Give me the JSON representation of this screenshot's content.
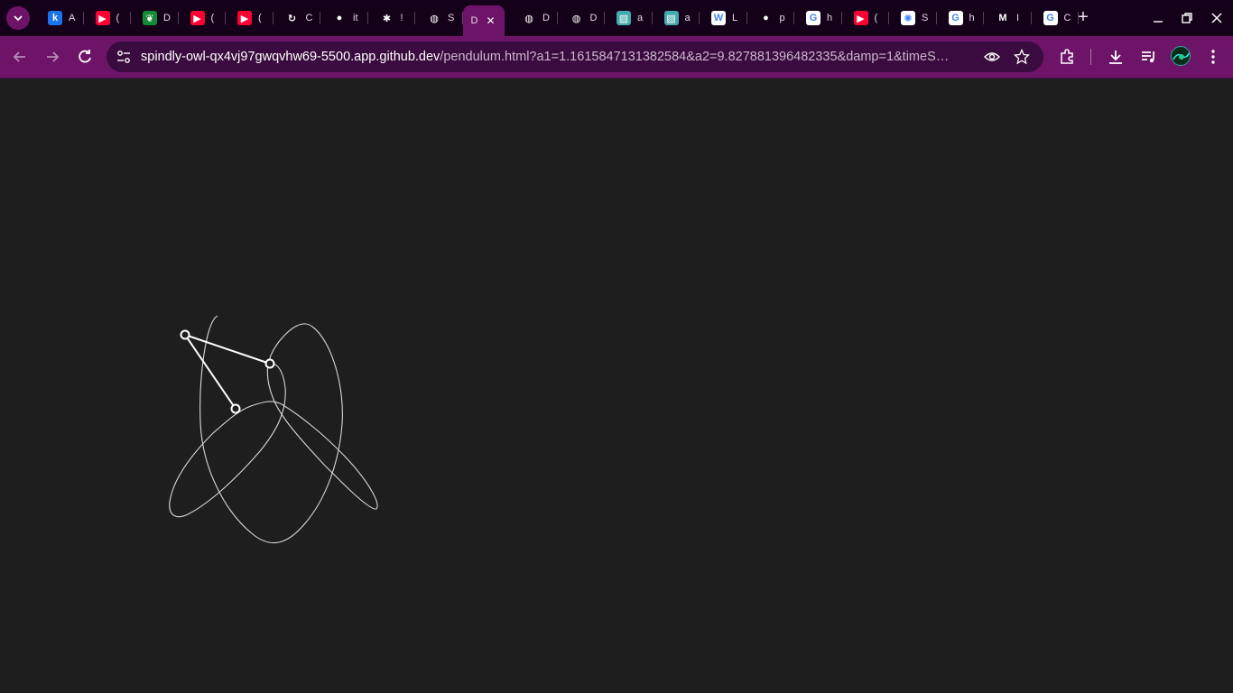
{
  "browser": {
    "tabs": [
      {
        "title": "A",
        "icon": "k-icon",
        "color": "#1a73e8",
        "glyph": "k"
      },
      {
        "title": "(",
        "icon": "youtube-icon",
        "color": "#ff0033",
        "glyph": "▶"
      },
      {
        "title": "D",
        "icon": "overleaf-icon",
        "color": "#138a36",
        "glyph": "❦"
      },
      {
        "title": "(",
        "icon": "youtube-icon",
        "color": "#ff0033",
        "glyph": "▶"
      },
      {
        "title": "(",
        "icon": "youtube-icon",
        "color": "#ff0033",
        "glyph": "▶"
      },
      {
        "title": "C",
        "icon": "openai-icon",
        "color": "#15001a",
        "glyph": "↻"
      },
      {
        "title": "it",
        "icon": "github-icon",
        "color": "#15001a",
        "glyph": "●"
      },
      {
        "title": "!",
        "icon": "slack-icon",
        "color": "#15001a",
        "glyph": "✱"
      },
      {
        "title": "S",
        "icon": "globe-icon",
        "color": "#15001a",
        "glyph": "◍"
      },
      {
        "title": "D",
        "icon": "none",
        "color": "#6e1468",
        "glyph": "",
        "active": true
      },
      {
        "title": "D",
        "icon": "globe-icon",
        "color": "#15001a",
        "glyph": "◍"
      },
      {
        "title": "D",
        "icon": "globe-icon",
        "color": "#15001a",
        "glyph": "◍"
      },
      {
        "title": "a",
        "icon": "arxiv-icon",
        "color": "#4aa",
        "glyph": "▧"
      },
      {
        "title": "a",
        "icon": "arxiv-icon",
        "color": "#4aa",
        "glyph": "▧"
      },
      {
        "title": "L",
        "icon": "wikipedia-icon",
        "color": "#ffffff",
        "glyph": "W"
      },
      {
        "title": "p",
        "icon": "github-icon",
        "color": "#15001a",
        "glyph": "●"
      },
      {
        "title": "h",
        "icon": "google-icon",
        "color": "#ffffff",
        "glyph": "G"
      },
      {
        "title": "(",
        "icon": "youtube-icon",
        "color": "#ff0033",
        "glyph": "▶"
      },
      {
        "title": "S",
        "icon": "chatgpt-icon",
        "color": "#ffffff",
        "glyph": "✺"
      },
      {
        "title": "h",
        "icon": "google-icon",
        "color": "#ffffff",
        "glyph": "G"
      },
      {
        "title": "I",
        "icon": "gmail-icon",
        "color": "#15001a",
        "glyph": "M"
      },
      {
        "title": "C",
        "icon": "google-icon",
        "color": "#ffffff",
        "glyph": "G"
      }
    ],
    "url_host": "spindly-owl-qx4vj97gwqvhw69-5500.app.github.dev",
    "url_path": "/pendulum.html?a1=1.1615847131382584&a2=9.827881396482335&damp=1&timeS…",
    "accent_color": "#6e1468",
    "tabstrip_color": "#15001a"
  },
  "page": {
    "background": "#1e1e1e",
    "pendulum": {
      "pivot": [
        205,
        371
      ],
      "bob1": [
        299,
        403
      ],
      "bob2": [
        261,
        453
      ],
      "trail_color": "#d8d8d8",
      "rod_color": "#ffffff"
    }
  }
}
